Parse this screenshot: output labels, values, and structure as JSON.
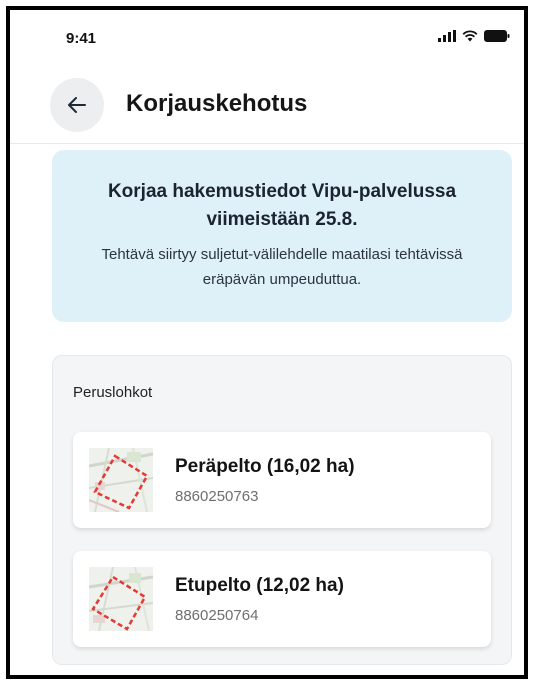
{
  "status_bar": {
    "time": "9:41",
    "icons": [
      "signal-icon",
      "wifi-icon",
      "battery-icon"
    ]
  },
  "header": {
    "back_icon": "arrow-left-icon",
    "title": "Korjauskehotus"
  },
  "notice": {
    "title": "Korjaa hakemustiedot Vipu-palvelussa viimeistään 25.8.",
    "body": "Tehtävä siirtyy suljetut-välilehdelle maatilasi tehtävissä eräpävän umpeuduttua."
  },
  "parcels": {
    "section_label": "Peruslohkot",
    "items": [
      {
        "name": "Peräpelto (16,02 ha)",
        "id": "8860250763",
        "thumbnail_icon": "map-thumbnail-icon"
      },
      {
        "name": "Etupelto (12,02 ha)",
        "id": "8860250764",
        "thumbnail_icon": "map-thumbnail-icon"
      }
    ]
  },
  "colors": {
    "notice_background": "#dff1f8",
    "card_background": "#f4f5f6",
    "back_button_background": "#eceef0",
    "parcel_outline": "#e53935"
  }
}
